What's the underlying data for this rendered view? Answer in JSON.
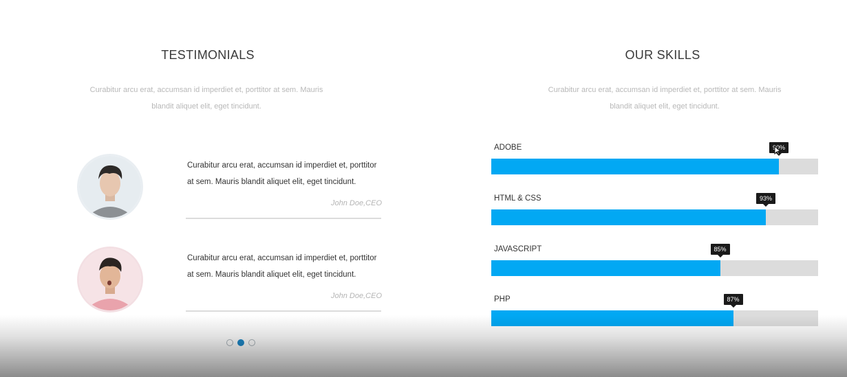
{
  "testimonials": {
    "title": "TESTIMONIALS",
    "subtitle_line1": "Curabitur arcu erat, accumsan id imperdiet et, porttitor at sem. Mauris",
    "subtitle_line2": "blandit aliquet elit, eget tincidunt.",
    "items": [
      {
        "text": "Curabitur arcu erat, accumsan id imperdiet et, porttitor at sem. Mauris blandit aliquet elit, eget tincidunt.",
        "author": "John Doe,CEO"
      },
      {
        "text": "Curabitur arcu erat, accumsan id imperdiet et, porttitor at sem. Mauris blandit aliquet elit, eget tincidunt.",
        "author": "John Doe,CEO"
      }
    ],
    "pagination": {
      "count": 3,
      "active_index": 1
    }
  },
  "skills": {
    "title": "OUR SKILLS",
    "subtitle_line1": "Curabitur arcu erat, accumsan id imperdiet et, porttitor at sem. Mauris",
    "subtitle_line2": "blandit aliquet elit, eget tincidunt.",
    "items": [
      {
        "name": "ADOBE",
        "label": "90%",
        "fill_percent": 88
      },
      {
        "name": "HTML & CSS",
        "label": "93%",
        "fill_percent": 84
      },
      {
        "name": "JAVASCRIPT",
        "label": "85%",
        "fill_percent": 70
      },
      {
        "name": "PHP",
        "label": "87%",
        "fill_percent": 74
      }
    ],
    "bar_color": "#02a8f3",
    "track_color": "#dcdcdc"
  }
}
